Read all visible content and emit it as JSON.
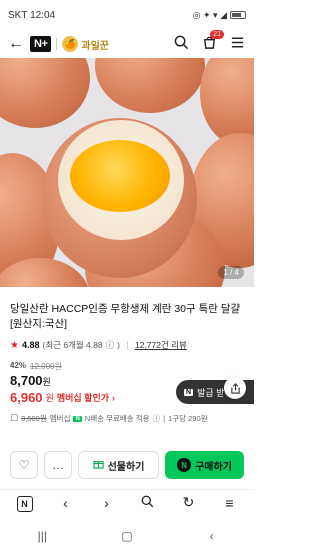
{
  "status_bar": {
    "carrier": "SKT",
    "time": "12:04",
    "icons": "◎ ✦ ▾ ◢"
  },
  "header": {
    "brand": "N+",
    "store_logo_glyph": "🍊",
    "store_name": "과일꾼",
    "cart_count": "21"
  },
  "image": {
    "counter": "1 / 4"
  },
  "product": {
    "title": "당일산란 HACCP인증 무항생제 계란 30구 특란 달걀 [원산지:국산]",
    "rating": "4.88",
    "rating_note": "(최근 6개월 4.88",
    "rating_icon": "ⓘ",
    "rating_close": ")",
    "reviews": "12,772건 리뷰",
    "discount_pct": "42%",
    "original_price": "12,000원",
    "price": "8,700",
    "price_unit": "원",
    "member_price": "6,960",
    "member_unit": "원",
    "member_label": "멤버십 할인가",
    "member_chev": "›"
  },
  "coupon": {
    "n": "N",
    "label": "발급 받"
  },
  "benefit": {
    "struck": "3,500원",
    "membership_label": "멤버십",
    "badge": "N",
    "text": "N배송 무료배송 적용",
    "info": "ⓘ",
    "sep": "|",
    "per_unit": "1구당 290원"
  },
  "actions": {
    "wish_icon": "♡",
    "chat_icon": "…",
    "gift_label": "선물하기",
    "buy_n": "N",
    "buy_label": "구매하기"
  },
  "browser_bar": {
    "n": "N"
  }
}
